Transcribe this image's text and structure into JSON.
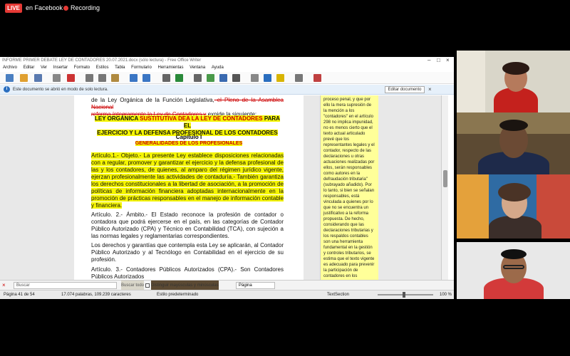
{
  "meeting": {
    "live_badge": "LIVE",
    "live_target": "en Facebook",
    "recording": "Recording"
  },
  "window": {
    "title": "INFORME PRIMER DEBATE LEY DE CONTADORES 20.07.2021.docx (sólo lectura) - Free Office Writer",
    "menu": [
      "Archivo",
      "Editar",
      "Ver",
      "Insertar",
      "Formato",
      "Estilos",
      "Tabla",
      "Formulario",
      "Herramientas",
      "Ventana",
      "Ayuda"
    ],
    "infobar": {
      "message": "Este documento se abrió en modo de solo lectura.",
      "edit_button": "Editar documento"
    }
  },
  "document": {
    "top_line_1": "de la Ley Orgánica de la Función Legislativa,",
    "top_line_1_red": " el Pleno de la Asamblea Nacional",
    "top_line_2_red": "reforma íntegramente la Ley de Contadores y",
    "top_line_2": " expide la siguiente:",
    "law_title_1": "LEY ORGÁNICA",
    "law_title_red": " SUSTITUTIVA DEA LA LEY DE CONTADORES",
    "law_title_2": " PARA EL",
    "law_title_3": "EJERCICIO Y LA DEFENSA PROFESIONAL DE LOS CONTADORES",
    "chapter": "Capítulo I",
    "chapter_subtitle": "GENERALIDADES DE LOS PROFESIONALES",
    "art1": "Artículo.1.- Objeto.- La presente Ley establece disposiciones relacionadas con a regular, promover y garantizar el ejercicio y la defensa profesional de las y los contadores, de quienes, al amparo del régimen jurídico vigente, ejerzan profesionalmente las actividades de contaduría.- También garantiza los derechos constitucionales a la libertad de asociación, a la promoción de políticas de información financiera adoptadas internacionalmente en la promoción de prácticas responsables en el manejo de información contable y financiera.",
    "art2": "Artículo. 2.- Ámbito.- El Estado reconoce la profesión de contador o contadora que podrá ejercerse en el país, en las categorías de Contador Público Autorizado (CPA) y Técnico en Contabilidad (TCA), con sujeción a las normas legales y reglamentarias correspondientes.",
    "art2b": "Los derechos y garantías que contempla esta Ley se aplicarán, al Contador Público Autorizado y al Tecnólogo en Contabilidad en el ejercicio de su profesión.",
    "art3": "Artículo. 3.- Contadores Públicos Autorizados (CPA).- Son Contadores Públicos Autorizados"
  },
  "comment": {
    "text": "proceso penal, y que por ello la mera supresión de la mención a los \"contadores\" en el artículo 298 no implica impunidad, no es menos cierto que el texto actual articulado prevé que los representantes legales y el contador, respecto de las declaraciones u otras actuaciones realizadas por ellos, serán responsables como autores en la defraudación tributaria\" (subrayado añadido). Por lo tanto, si bien se señalan responsables, está vinculada a quienes por lo que no se encuentra un justificativo a la reforma propuesta. De hecho, considerando que las declaraciones tributarias y los respaldos contables son una herramienta fundamental en la gestión y controles tributarios, se estima que el texto vigente es adecuado para prevenir la participación de contadores en los esquemas de defraudación.\n\nSe recomienda adecuar el texto conforme lo propuesto en la Disposición Reformatoria Única, en el caso de que si se vaya a"
  },
  "findbar": {
    "placeholder": "Buscar",
    "find_all": "Buscar todo",
    "match_case": "Distinguir mayúsculas y minúsculas",
    "page_box": "Página"
  },
  "status": {
    "page": "Página 41 de 54",
    "words": "17.074 palabras, 109.239 caracteres",
    "style": "Estilo predeterminado",
    "section": "TextSection",
    "zoom": "100 %"
  }
}
